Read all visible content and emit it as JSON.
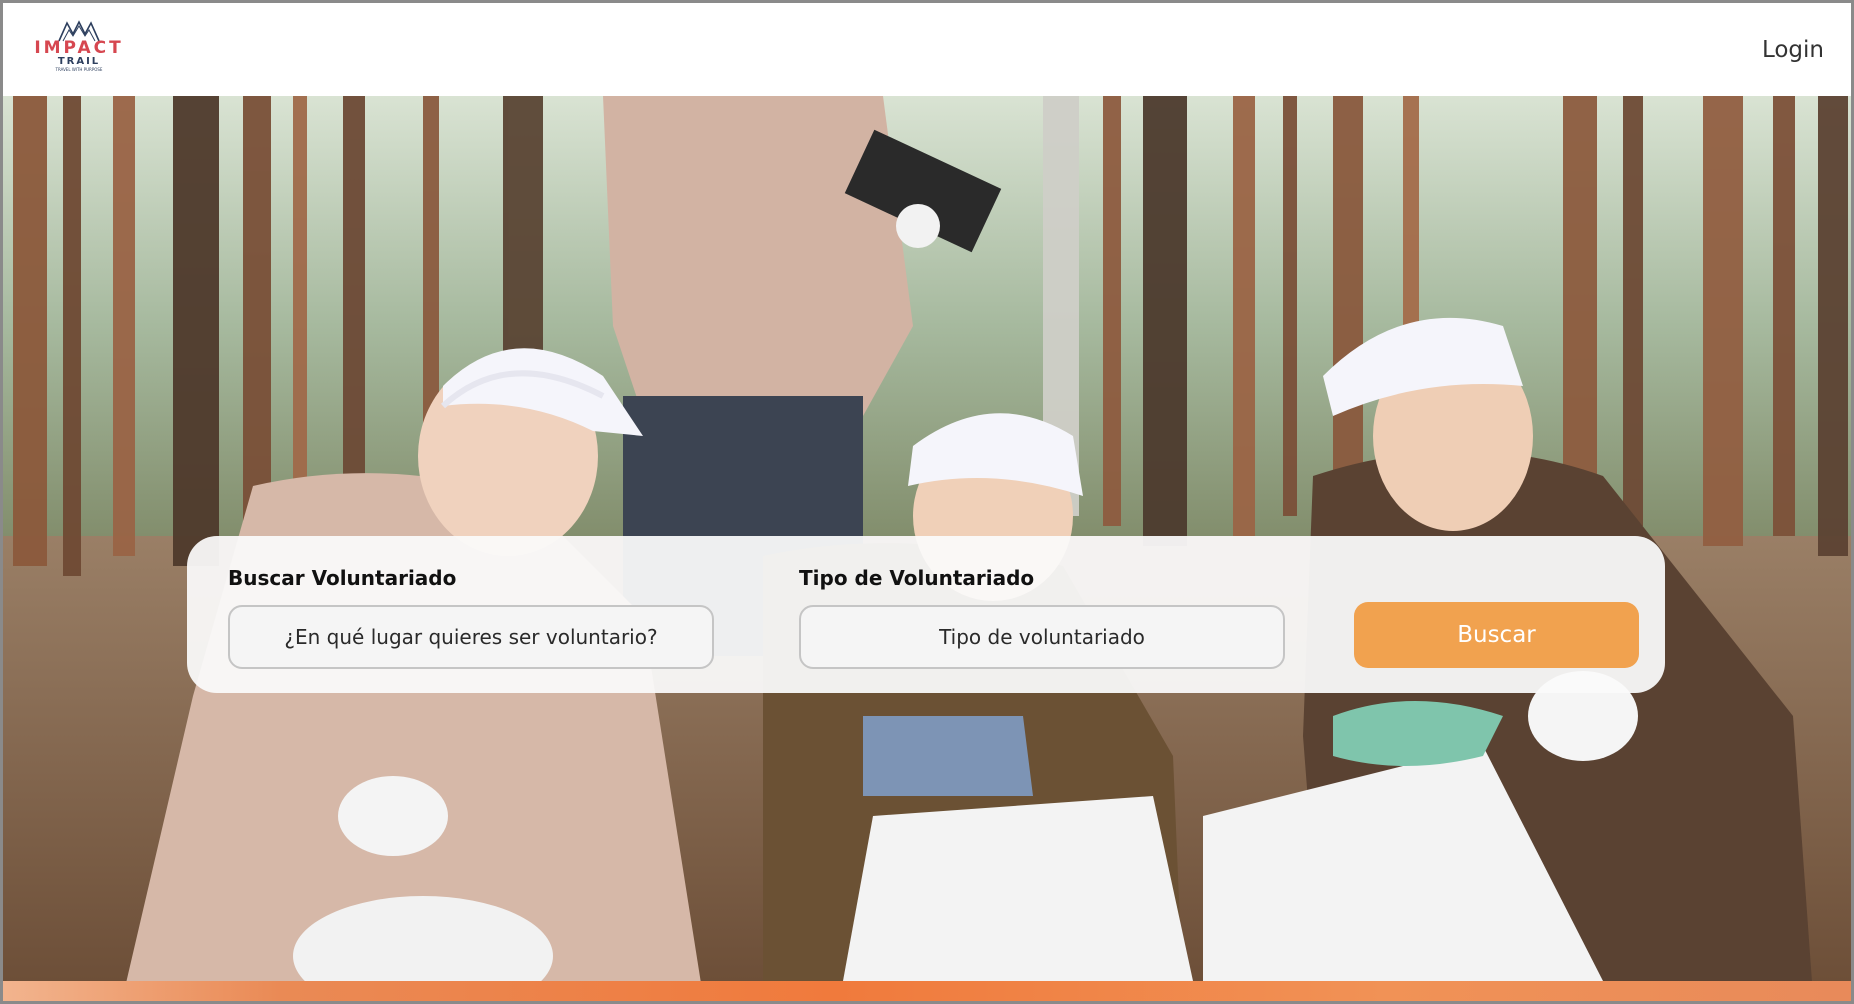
{
  "header": {
    "logo": {
      "word": "IMPACT",
      "sub": "TRAIL",
      "tagline": "TRAVEL WITH PURPOSE",
      "colors": {
        "primary": "#d64750",
        "secondary": "#2d3f5e"
      }
    },
    "login_label": "Login"
  },
  "hero": {
    "image_description_icon": "volunteers-forest-photo"
  },
  "search": {
    "location_label": "Buscar Voluntariado",
    "location_placeholder": "¿En qué lugar quieres ser voluntario?",
    "type_label": "Tipo de Voluntariado",
    "type_placeholder": "Tipo de voluntariado",
    "button_label": "Buscar",
    "button_color": "#f1a24f"
  }
}
